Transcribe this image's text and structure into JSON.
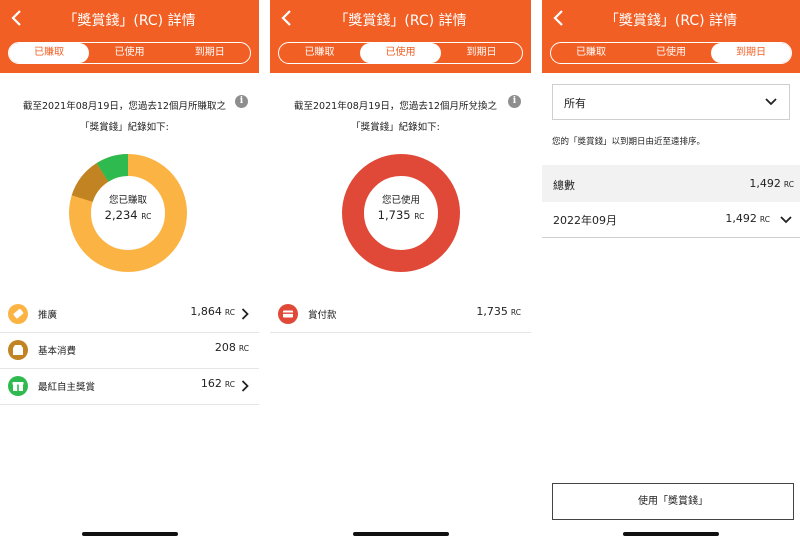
{
  "screens": [
    {
      "title": "「獎賞錢」(RC) 詳情",
      "tabs": [
        "已賺取",
        "已使用",
        "到期日"
      ],
      "active_tab": 0,
      "intro_line1": "截至2021年08月19日，您過去12個月所賺取之",
      "intro_line2": "「獎賞錢」紀錄如下:",
      "donut_caption": "您已賺取",
      "donut_total": "2,234",
      "unit": "RC",
      "donut_colors": [
        "#fbb444",
        "#c28422",
        "#2fba4f"
      ],
      "rows": [
        {
          "label": "推廣",
          "value": "1,864",
          "color": "#fbb444"
        },
        {
          "label": "基本消費",
          "value": "208",
          "color": "#c28422"
        },
        {
          "label": "最紅自主獎賞",
          "value": "162",
          "color": "#2fba4f"
        }
      ]
    },
    {
      "title": "「獎賞錢」(RC) 詳情",
      "tabs": [
        "已賺取",
        "已使用",
        "到期日"
      ],
      "active_tab": 1,
      "intro_line1": "截至2021年08月19日，您過去12個月所兌換之",
      "intro_line2": "「獎賞錢」紀錄如下:",
      "donut_caption": "您已使用",
      "donut_total": "1,735",
      "unit": "RC",
      "donut_color": "#e04838",
      "rows": [
        {
          "label": "賞付款",
          "value": "1,735",
          "color": "#e04838"
        }
      ]
    },
    {
      "title": "「獎賞錢」(RC) 詳情",
      "tabs": [
        "已賺取",
        "已使用",
        "到期日"
      ],
      "active_tab": 2,
      "filter_value": "所有",
      "note": "您的「獎賞錢」以到期日由近至遠排序。",
      "total_label": "總數",
      "total_value": "1,492",
      "month_label": "2022年09月",
      "month_value": "1,492",
      "unit": "RC",
      "use_button": "使用「獎賞錢」"
    }
  ],
  "colors": {
    "brand": "#f25f24"
  },
  "icons": {
    "back": "chevron-left-icon",
    "info": "info-icon",
    "tag": "tag-icon",
    "shop": "shop-icon",
    "gift": "gift-icon",
    "card": "card-icon",
    "chevron": "chevron-right-icon",
    "dropdown": "chevron-down-icon"
  }
}
